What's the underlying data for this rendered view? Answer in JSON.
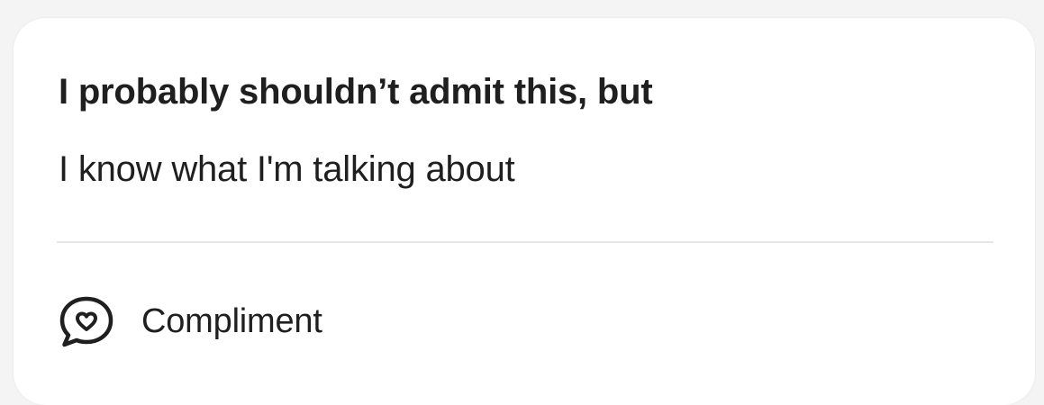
{
  "card": {
    "prompt": "I probably shouldn’t admit this, but",
    "answer": "I know what I'm talking about",
    "compliment_label": "Compliment",
    "compliment_icon": "heart-chat-bubble-icon"
  },
  "colors": {
    "text": "#1f1f1f",
    "card_background": "#ffffff",
    "page_background": "#f4f4f4",
    "divider": "#e6e6e6"
  }
}
